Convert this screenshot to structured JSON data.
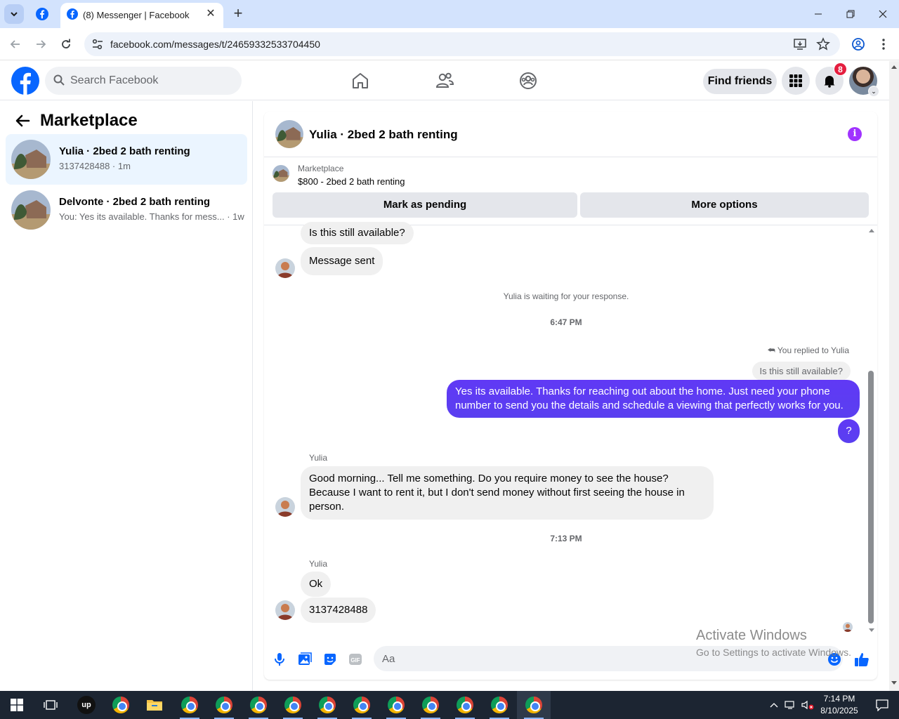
{
  "browser": {
    "tab_title": "(8) Messenger | Facebook",
    "url": "facebook.com/messages/t/24659332533704450"
  },
  "header": {
    "search_placeholder": "Search Facebook",
    "find_friends": "Find friends",
    "notification_count": "8"
  },
  "sidebar": {
    "title": "Marketplace",
    "conversations": [
      {
        "name": "Yulia · 2bed 2 bath renting",
        "preview": "3137428488 · 1m",
        "active": true
      },
      {
        "name": "Delvonte · 2bed 2 bath renting",
        "preview": "You: Yes its available. Thanks for mess... · 1w",
        "active": false
      }
    ]
  },
  "chat": {
    "title": "Yulia · 2bed 2 bath renting",
    "listing_label": "Marketplace",
    "listing_price": "$800 - 2bed 2 bath renting",
    "mark_pending": "Mark as pending",
    "more_options": "More options",
    "messages": {
      "m1": "Is this still available?",
      "m2": "Message sent",
      "waiting": "Yulia is waiting for your response.",
      "time1": "6:47 PM",
      "reply_note": "You replied to Yulia",
      "reply_quote": "Is this still available?",
      "out1": "Yes its available. Thanks for reaching out about the home. Just need your phone number to send you the details and schedule a viewing that perfectly works for you.",
      "out2": "?",
      "sender1": "Yulia",
      "in1": "Good morning... Tell me something. Do you require money to see the house? Because I want to rent it, but I don't send money without first seeing the house in person.",
      "time2": "7:13 PM",
      "sender2": "Yulia",
      "in2": "Ok",
      "in3": "3137428488"
    },
    "composer_placeholder": "Aa"
  },
  "watermark": {
    "line1": "Activate Windows",
    "line2": "Go to Settings to activate Windows."
  },
  "taskbar": {
    "time": "7:14 PM",
    "date": "8/10/2025"
  },
  "colors": {
    "fb_blue": "#0866ff",
    "outgoing_bubble": "#5b3cf5",
    "active_convo": "#ebf5ff"
  }
}
